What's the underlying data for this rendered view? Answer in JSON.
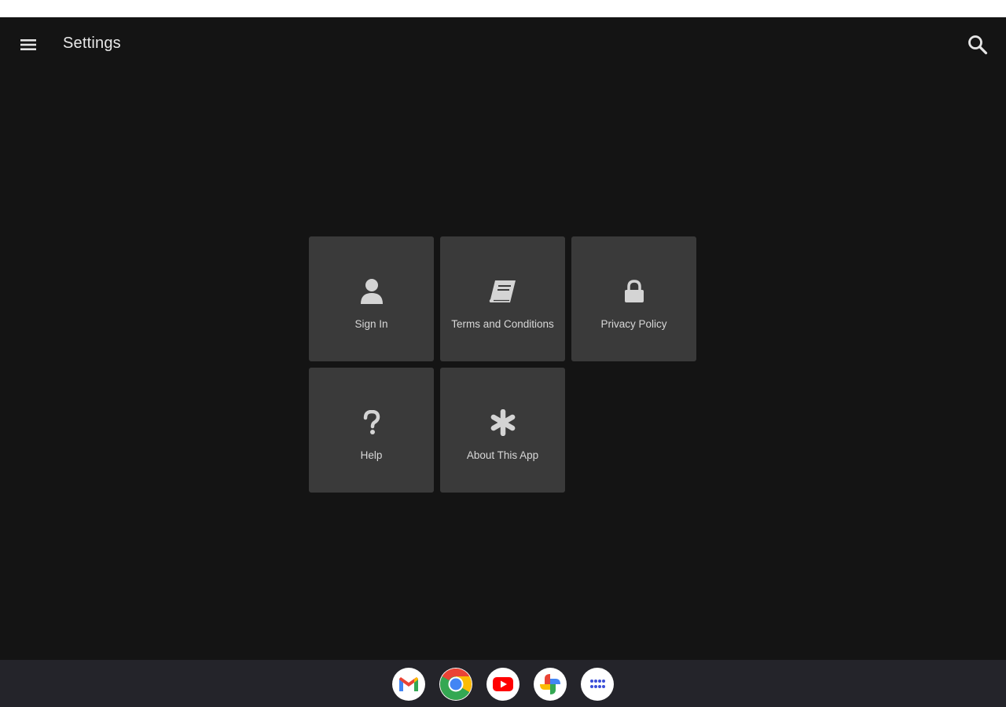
{
  "toolbar": {
    "title": "Settings",
    "menu_icon": "hamburger-menu-icon",
    "search_icon": "search-icon"
  },
  "tiles": [
    {
      "label": "Sign In",
      "icon": "person-icon"
    },
    {
      "label": "Terms and Conditions",
      "icon": "book-icon"
    },
    {
      "label": "Privacy Policy",
      "icon": "lock-icon"
    },
    {
      "label": "Help",
      "icon": "question-mark-icon"
    },
    {
      "label": "About This App",
      "icon": "asterisk-icon"
    }
  ],
  "shelf": {
    "apps": [
      {
        "name": "Gmail",
        "icon": "gmail-icon"
      },
      {
        "name": "Chrome",
        "icon": "chrome-icon"
      },
      {
        "name": "YouTube",
        "icon": "youtube-icon"
      },
      {
        "name": "Photos",
        "icon": "photos-icon"
      },
      {
        "name": "Launcher",
        "icon": "app-launcher-icon"
      }
    ]
  },
  "colors": {
    "background": "#141414",
    "tile": "#3a3a3a",
    "text": "#d8d8d8",
    "shelf": "#24242a"
  }
}
